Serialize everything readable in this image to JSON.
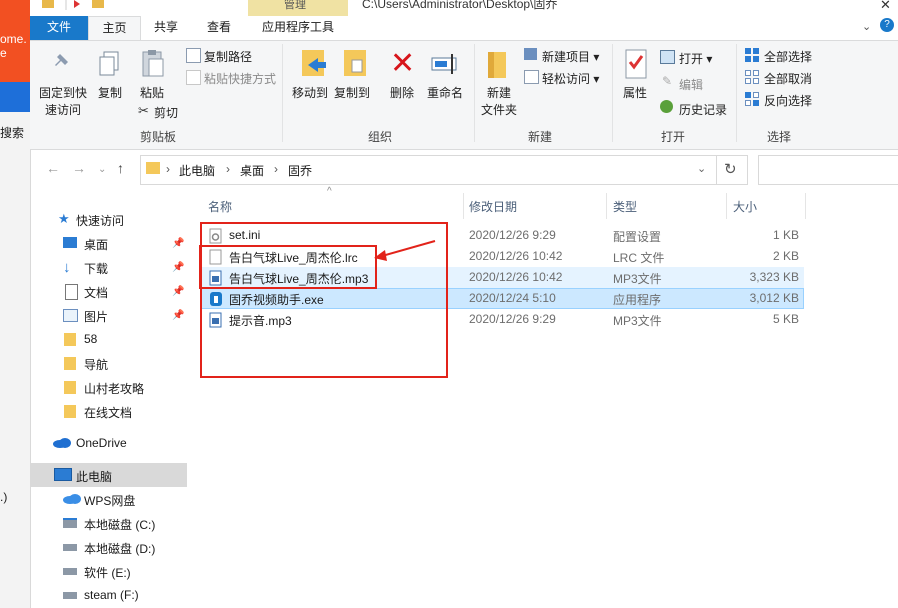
{
  "background_window": {
    "text1": "ome.",
    "text1b": "e",
    "text2": "搜索",
    "text3": ".)"
  },
  "title_bar": {
    "context_tab": "管理",
    "path": "C:\\Users\\Administrator\\Desktop\\固乔"
  },
  "tabs": [
    "文件",
    "主页",
    "共享",
    "查看",
    "应用程序工具"
  ],
  "ribbon": {
    "clipboard": {
      "pin": [
        "固定到快",
        "速访问"
      ],
      "copy": "复制",
      "paste": "粘贴",
      "copy_path": "复制路径",
      "paste_shortcut": "粘贴快捷方式",
      "cut": "剪切",
      "group": "剪贴板"
    },
    "organize": {
      "move_to": "移动到",
      "copy_to": "复制到",
      "delete": "删除",
      "rename": "重命名",
      "group": "组织"
    },
    "new": {
      "new_folder": [
        "新建",
        "文件夹"
      ],
      "new_item": "新建项目",
      "easy_access": "轻松访问",
      "group": "新建"
    },
    "open": {
      "properties": "属性",
      "open": "打开",
      "edit": "编辑",
      "history": "历史记录",
      "group": "打开"
    },
    "select": {
      "select_all": "全部选择",
      "select_none": "全部取消",
      "invert": "反向选择",
      "group": "选择"
    }
  },
  "address": {
    "parts": [
      "此电脑",
      "桌面",
      "固乔"
    ]
  },
  "nav_pane": {
    "quick_access": "快速访问",
    "items": [
      "桌面",
      "下载",
      "文档",
      "图片",
      "58",
      "导航",
      "山村老攻略",
      "在线文档"
    ],
    "onedrive": "OneDrive",
    "this_pc": "此电脑",
    "drives": [
      "WPS网盘",
      "本地磁盘 (C:)",
      "本地磁盘 (D:)",
      "软件 (E:)",
      "steam (F:)"
    ]
  },
  "columns": [
    "名称",
    "修改日期",
    "类型",
    "大小"
  ],
  "files": [
    {
      "name": "set.ini",
      "date": "2020/12/26 9:29",
      "type": "配置设置",
      "size": "1 KB"
    },
    {
      "name": "告白气球Live_周杰伦.lrc",
      "date": "2020/12/26 10:42",
      "type": "LRC 文件",
      "size": "2 KB"
    },
    {
      "name": "告白气球Live_周杰伦.mp3",
      "date": "2020/12/26 10:42",
      "type": "MP3文件",
      "size": "3,323 KB"
    },
    {
      "name": "固乔视频助手.exe",
      "date": "2020/12/24 5:10",
      "type": "应用程序",
      "size": "3,012 KB"
    },
    {
      "name": "提示音.mp3",
      "date": "2020/12/26 9:29",
      "type": "MP3文件",
      "size": "5 KB"
    }
  ],
  "colors": {
    "accent": "#1979ca",
    "selection": "#cce8ff",
    "hover": "#e5f3ff",
    "annotation": "#e2231a"
  }
}
